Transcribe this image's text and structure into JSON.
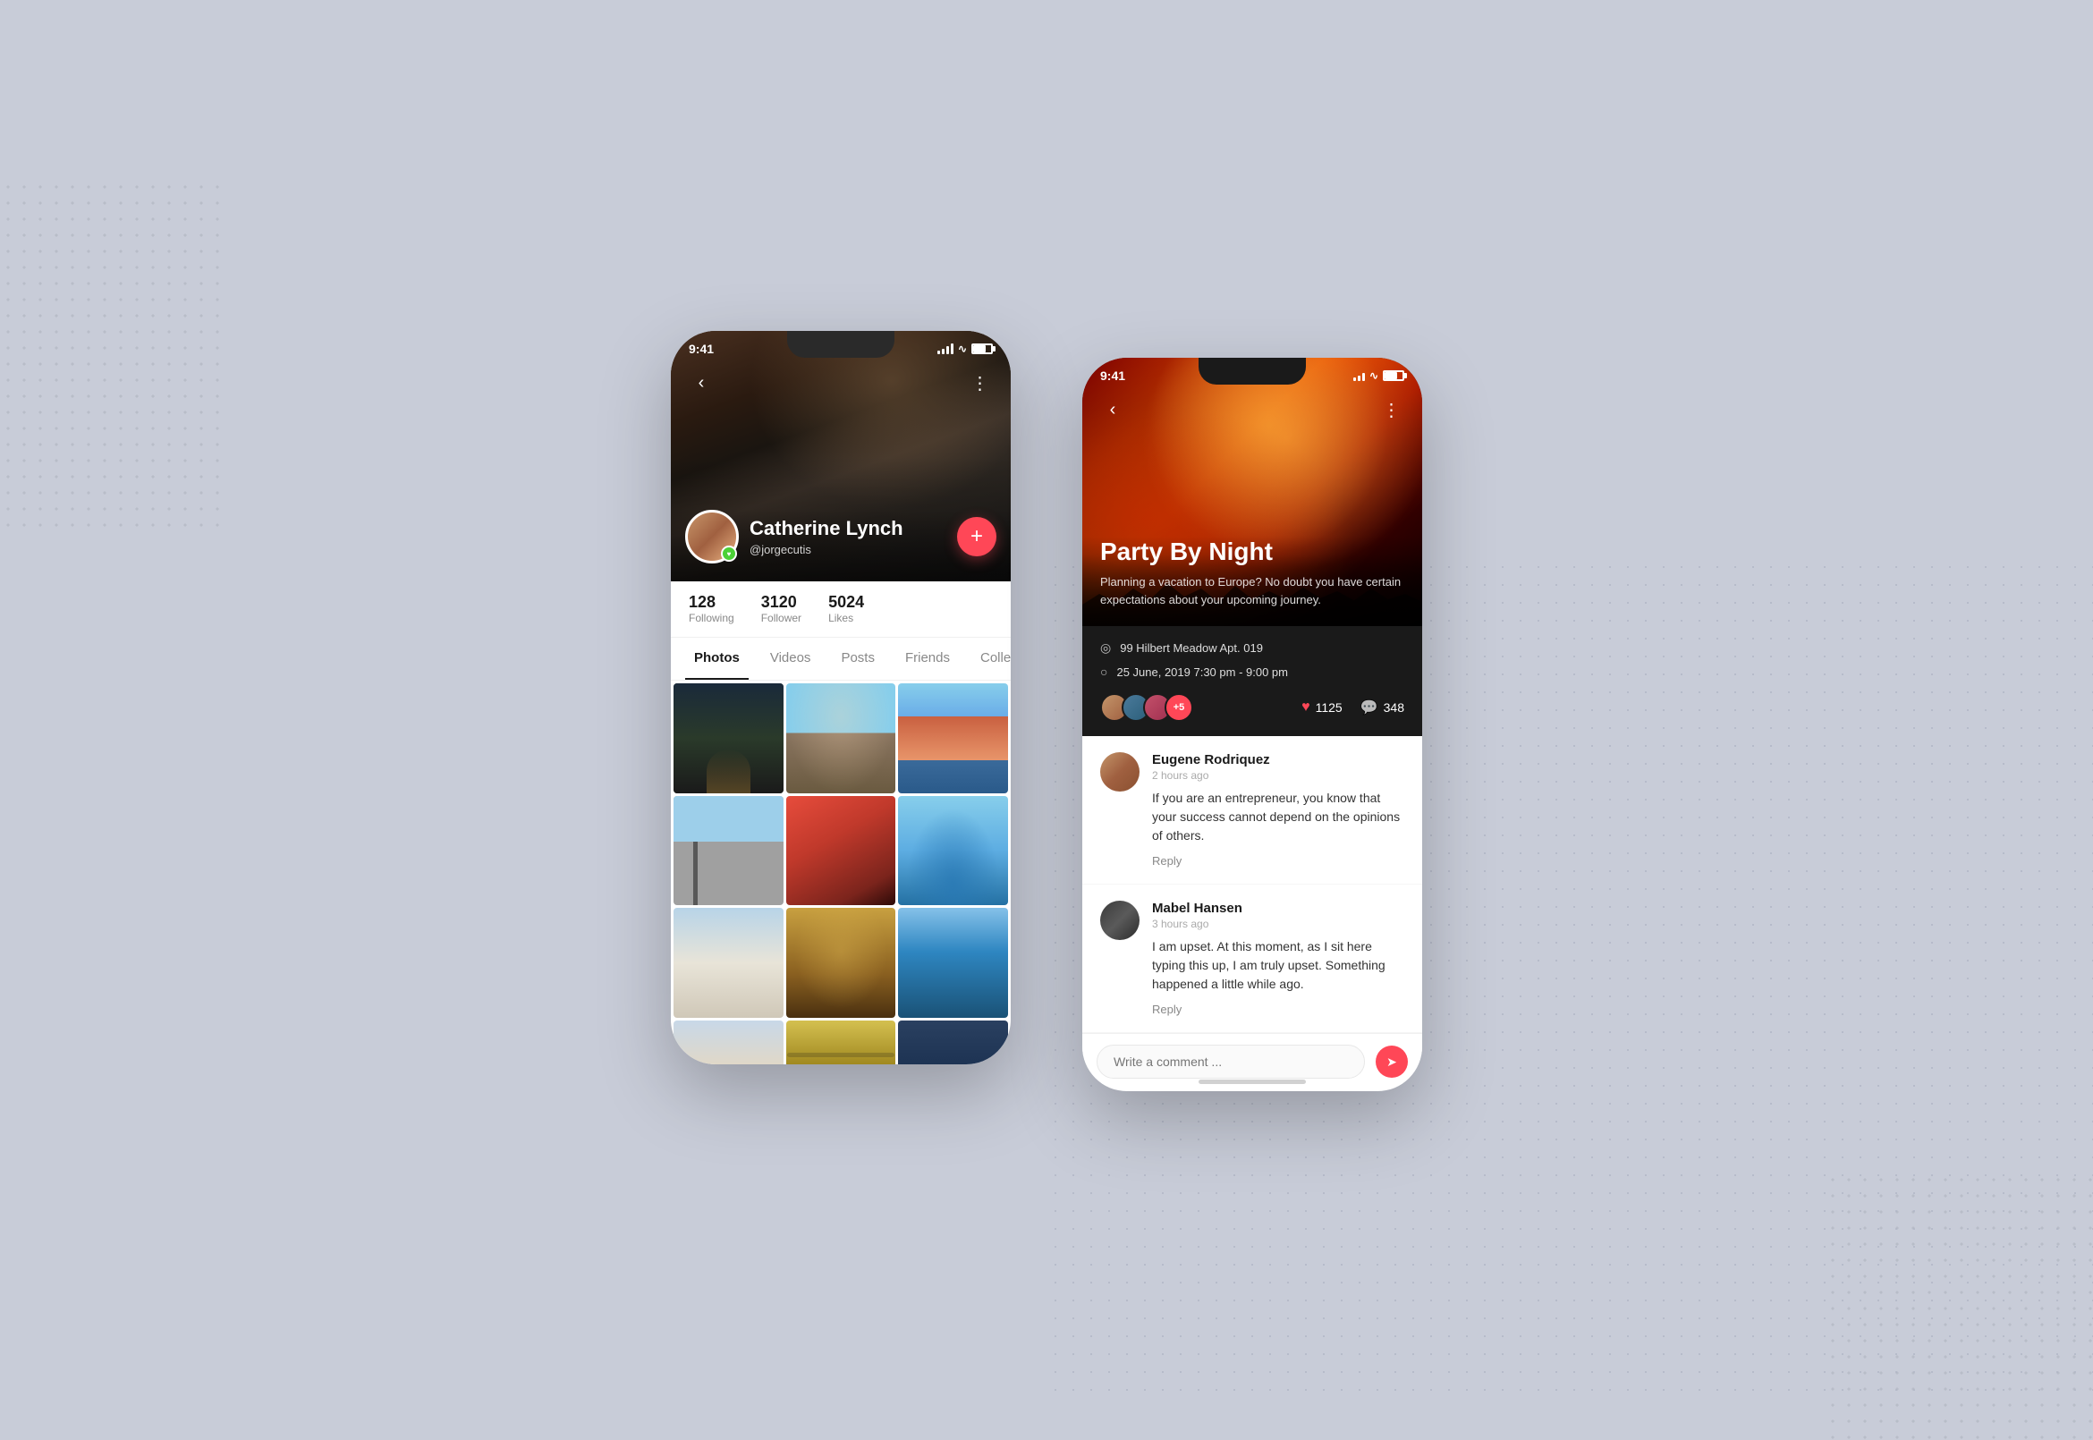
{
  "background": {
    "color": "#c8ccd8"
  },
  "phone1": {
    "status_bar": {
      "time": "9:41",
      "signal": "●●●●",
      "wifi": "wifi",
      "battery": "battery"
    },
    "profile": {
      "name": "Catherine Lynch",
      "handle": "@jorgecutis",
      "stats": [
        {
          "number": "128",
          "label": "Following"
        },
        {
          "number": "3120",
          "label": "Follower"
        },
        {
          "number": "5024",
          "label": "Likes"
        }
      ],
      "fab_label": "+"
    },
    "tabs": [
      "Photos",
      "Videos",
      "Posts",
      "Friends",
      "Collec..."
    ],
    "active_tab": "Photos",
    "photos": [
      "photo-1",
      "photo-2",
      "photo-3",
      "photo-4",
      "photo-5",
      "photo-6",
      "photo-7",
      "photo-8",
      "photo-9",
      "photo-10",
      "photo-11",
      "photo-12"
    ]
  },
  "phone2": {
    "status_bar": {
      "time": "9:41",
      "signal": "●●●",
      "wifi": "wifi",
      "battery": "battery"
    },
    "event": {
      "title": "Party By Night",
      "description": "Planning a vacation to Europe? No doubt you have certain expectations about your upcoming journey.",
      "location": "99 Hilbert Meadow Apt. 019",
      "datetime": "25 June, 2019 7:30 pm - 9:00 pm",
      "likes": "1125",
      "comments_count": "348",
      "attendees_extra": "+5"
    },
    "comments": [
      {
        "author": "Eugene Rodriquez",
        "time": "2 hours ago",
        "text": "If you are an entrepreneur, you know that your success cannot depend on the opinions of others.",
        "reply_label": "Reply"
      },
      {
        "author": "Mabel Hansen",
        "time": "3 hours ago",
        "text": "I am upset. At this moment, as I sit here typing this up, I am truly upset. Something happened a little while ago.",
        "reply_label": "Reply"
      }
    ],
    "comment_input": {
      "placeholder": "Write a comment ...",
      "send_icon": "➤"
    },
    "back_label": "‹",
    "more_label": "⋮"
  }
}
